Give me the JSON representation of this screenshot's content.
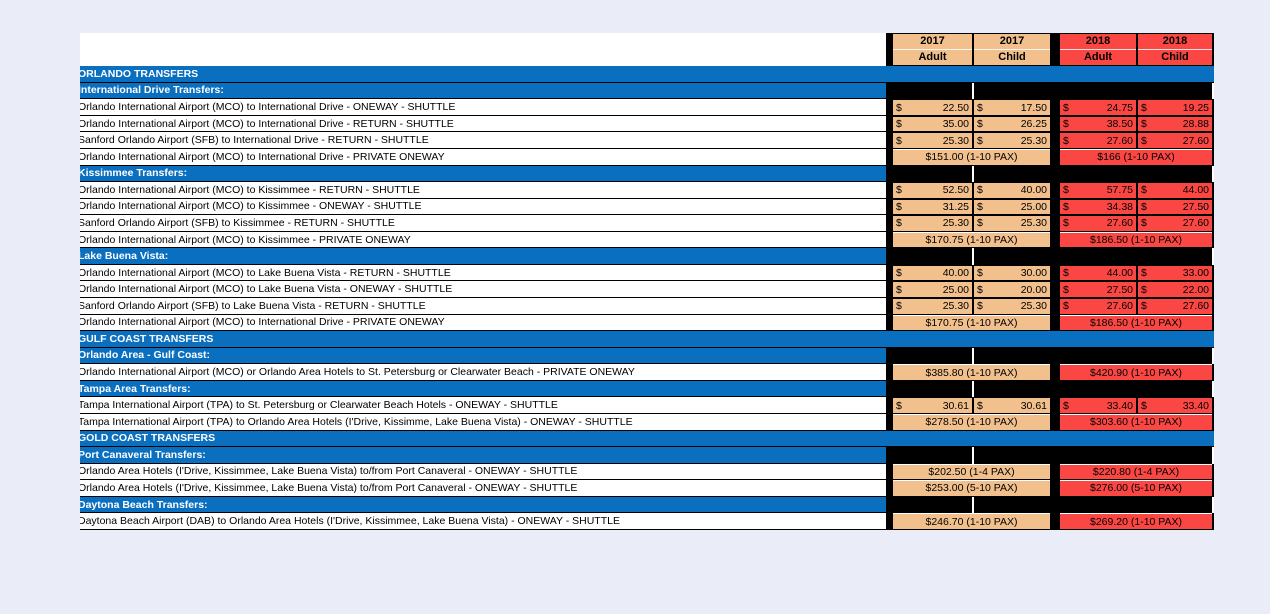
{
  "colors": {
    "page_background": "#eaedf7",
    "section_blue": "#0b6fc0",
    "year_2017_fill": "#f2c08d",
    "year_2018_fill": "#fa4743",
    "filler_black": "#000000",
    "cell_white": "#ffffff"
  },
  "header": {
    "row1": [
      "2017",
      "2017",
      "2018",
      "2018"
    ],
    "row2": [
      "Adult",
      "Child",
      "Adult",
      "Child"
    ]
  },
  "currency_symbol": "$",
  "rows": [
    {
      "type": "section",
      "label": "ORLANDO TRANSFERS"
    },
    {
      "type": "sub",
      "label": "International Drive Transfers:"
    },
    {
      "type": "prices",
      "label": "Orlando International Airport (MCO) to International Drive - ONEWAY - SHUTTLE",
      "values": [
        "22.50",
        "17.50",
        "24.75",
        "19.25"
      ]
    },
    {
      "type": "prices",
      "label": "Orlando International Airport (MCO) to International Drive - RETURN - SHUTTLE",
      "values": [
        "35.00",
        "26.25",
        "38.50",
        "28.88"
      ]
    },
    {
      "type": "prices",
      "label": "Sanford Orlando Airport (SFB) to International Drive - RETURN - SHUTTLE",
      "values": [
        "25.30",
        "25.30",
        "27.60",
        "27.60"
      ]
    },
    {
      "type": "merged",
      "label": "Orlando International Airport (MCO) to International Drive - PRIVATE ONEWAY",
      "v2017": "$151.00 (1-10 PAX)",
      "v2018": "$166 (1-10 PAX)"
    },
    {
      "type": "sub",
      "label": "Kissimmee Transfers:"
    },
    {
      "type": "prices",
      "label": "Orlando International Airport (MCO) to Kissimmee - RETURN - SHUTTLE",
      "values": [
        "52.50",
        "40.00",
        "57.75",
        "44.00"
      ]
    },
    {
      "type": "prices",
      "label": "Orlando International Airport (MCO) to Kissimmee - ONEWAY - SHUTTLE",
      "values": [
        "31.25",
        "25.00",
        "34.38",
        "27.50"
      ]
    },
    {
      "type": "prices",
      "label": "Sanford Orlando Airport (SFB) to Kissimmee - RETURN - SHUTTLE",
      "values": [
        "25.30",
        "25.30",
        "27.60",
        "27.60"
      ]
    },
    {
      "type": "merged",
      "label": "Orlando International Airport (MCO) to Kissimmee - PRIVATE ONEWAY",
      "v2017": "$170.75 (1-10 PAX)",
      "v2018": "$186.50 (1-10 PAX)"
    },
    {
      "type": "sub",
      "label": "Lake Buena Vista:"
    },
    {
      "type": "prices",
      "label": "Orlando International Airport (MCO) to Lake Buena Vista - RETURN - SHUTTLE",
      "values": [
        "40.00",
        "30.00",
        "44.00",
        "33.00"
      ]
    },
    {
      "type": "prices",
      "label": "Orlando International Airport (MCO) to Lake Buena Vista - ONEWAY - SHUTTLE",
      "values": [
        "25.00",
        "20.00",
        "27.50",
        "22.00"
      ]
    },
    {
      "type": "prices",
      "label": "Sanford Orlando Airport (SFB) to Lake Buena Vista - RETURN - SHUTTLE",
      "values": [
        "25.30",
        "25.30",
        "27.60",
        "27.60"
      ]
    },
    {
      "type": "merged",
      "label": "Orlando International Airport (MCO) to International Drive - PRIVATE ONEWAY",
      "v2017": "$170.75 (1-10 PAX)",
      "v2018": "$186.50 (1-10 PAX)"
    },
    {
      "type": "section",
      "label": "GULF COAST TRANSFERS"
    },
    {
      "type": "sub",
      "label": "Orlando Area - Gulf Coast:"
    },
    {
      "type": "merged",
      "label": "Orlando International Airport (MCO) or Orlando Area Hotels to St. Petersburg or Clearwater Beach - PRIVATE ONEWAY",
      "v2017": "$385.80 (1-10 PAX)",
      "v2018": "$420.90 (1-10 PAX)"
    },
    {
      "type": "sub",
      "label": "Tampa Area Transfers:"
    },
    {
      "type": "prices",
      "label": "Tampa International Airport (TPA) to St. Petersburg or Clearwater Beach Hotels - ONEWAY - SHUTTLE",
      "values": [
        "30.61",
        "30.61",
        "33.40",
        "33.40"
      ]
    },
    {
      "type": "merged",
      "label": "Tampa International Airport (TPA) to Orlando Area Hotels (I'Drive, Kissimme, Lake Buena Vista) - ONEWAY - SHUTTLE",
      "v2017": "$278.50 (1-10 PAX)",
      "v2018": "$303.60 (1-10 PAX)"
    },
    {
      "type": "section",
      "label": "GOLD COAST TRANSFERS"
    },
    {
      "type": "sub",
      "label": "Port Canaveral Transfers:"
    },
    {
      "type": "merged",
      "label": "Orlando Area Hotels (I'Drive, Kissimmee, Lake Buena Vista) to/from Port Canaveral - ONEWAY - SHUTTLE",
      "v2017": "$202.50 (1-4 PAX)",
      "v2018": "$220.80 (1-4 PAX)"
    },
    {
      "type": "merged",
      "label": "Orlando Area Hotels (I'Drive, Kissimmee, Lake Buena Vista) to/from Port Canaveral - ONEWAY - SHUTTLE",
      "v2017": "$253.00 (5-10 PAX)",
      "v2018": "$276.00 (5-10 PAX)"
    },
    {
      "type": "sub",
      "label": "Daytona Beach Transfers:"
    },
    {
      "type": "merged",
      "label": "Daytona Beach Airport (DAB) to Orlando Area Hotels (I'Drive, Kissimmee, Lake Buena Vista) - ONEWAY - SHUTTLE",
      "v2017": "$246.70 (1-10 PAX)",
      "v2018": "$269.20 (1-10 PAX)"
    }
  ]
}
